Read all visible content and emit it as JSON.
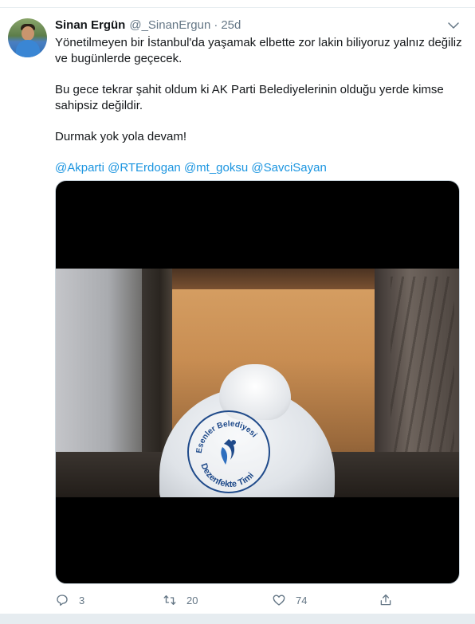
{
  "tweet": {
    "author_name": "Sinan Ergün",
    "author_handle": "@_SinanErgun",
    "separator": "·",
    "time": "25d",
    "paragraphs": [
      "Yönetilmeyen bir İstanbul'da yaşamak elbette zor lakin biliyoruz yalnız değiliz ve bugünlerde geçecek.",
      "Bu gece tekrar şahit oldum ki AK Parti Belediyelerinin olduğu yerde kimse sahipsiz değildir.",
      "Durmak yok yola devam!"
    ],
    "mentions": [
      "@Akparti",
      "@RTErdogan",
      "@mt_goksu",
      "@SavciSayan"
    ]
  },
  "media": {
    "logo_text_top": "Esenler Belediyesi",
    "logo_text_bottom": "Dezenfekte Timi"
  },
  "actions": {
    "reply_count": "3",
    "retweet_count": "20",
    "like_count": "74"
  },
  "icons": {
    "caret": "chevron-down-icon",
    "reply": "reply-icon",
    "retweet": "retweet-icon",
    "like": "heart-icon",
    "share": "share-icon"
  },
  "colors": {
    "link": "#1b95e0",
    "secondary_text": "#657786",
    "primary_text": "#14171a",
    "logo_blue": "#1f4a8a"
  }
}
